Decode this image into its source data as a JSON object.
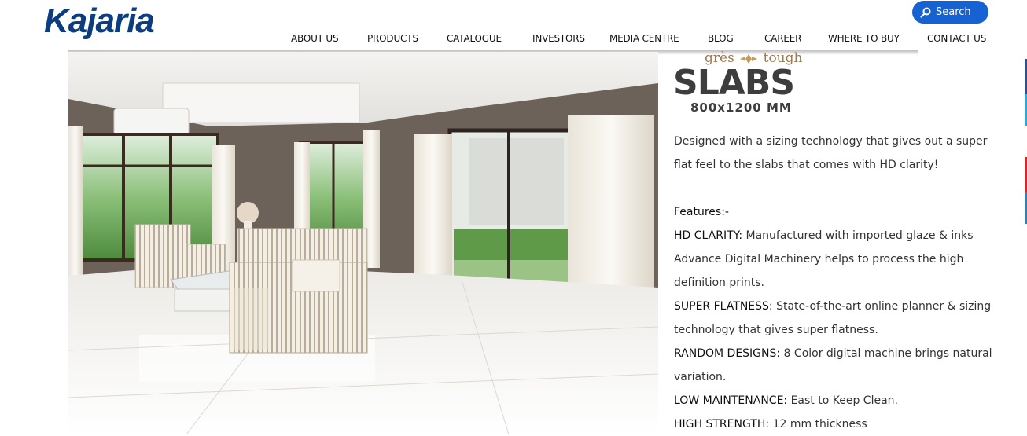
{
  "header": {
    "logo_text": "Kajaria",
    "search_label": "Search",
    "nav": [
      "ABOUT US",
      "PRODUCTS",
      "CATALOGUE",
      "INVESTORS",
      "MEDIA CENTRE",
      "BLOG",
      "CAREER",
      "WHERE TO BUY",
      "CONTACT US"
    ]
  },
  "badge": {
    "brand_left": "grès",
    "brand_right": "tough",
    "title": "SLABS",
    "size": "800x1200 MM"
  },
  "content": {
    "intro": "Designed with a sizing technology that gives out a super flat feel to the slabs that comes with HD clarity!",
    "features_title": "Features:-",
    "features": [
      {
        "label": "HD CLARITY:",
        "text": " Manufactured with imported glaze & inks Advance Digital Machinery helps to process the high definition prints."
      },
      {
        "label": "SUPER FLATNESS:",
        "text": " State-of-the-art online planner & sizing technology that gives super flatness."
      },
      {
        "label": "RANDOM DESIGNS:",
        "text": " 8 Color digital machine brings natural variation."
      },
      {
        "label": "LOW MAINTENANCE:",
        "text": " East to Keep Clean."
      },
      {
        "label": "HIGH STRENGTH:",
        "text": " 12 mm thickness"
      }
    ]
  },
  "colors": {
    "logo": "#0b3d7f",
    "search_bg": "#1762d2",
    "social": [
      "#2d4f8e",
      "#29a7df",
      "#d8232a",
      "#2f7fb5"
    ]
  },
  "icons": [
    "search-icon",
    "brand-emblem-icon"
  ]
}
